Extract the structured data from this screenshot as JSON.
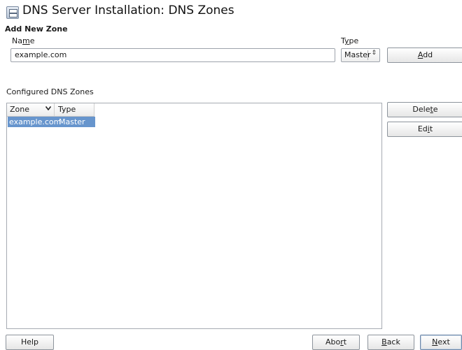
{
  "header": {
    "title": "DNS Server Installation: DNS Zones",
    "icon": "dns-server-icon"
  },
  "add_zone": {
    "section_title": "Add New Zone",
    "name_label_pre": "Na",
    "name_label_u": "m",
    "name_label_post": "e",
    "name_value": "example.com",
    "type_label_pre": "T",
    "type_label_u": "y",
    "type_label_post": "pe",
    "type_selected": "Master",
    "add_pre": "",
    "add_u": "A",
    "add_post": "dd"
  },
  "zones": {
    "label": "Configured DNS Zones",
    "columns": [
      "Zone",
      "Type"
    ],
    "rows": [
      {
        "zone": "example.com",
        "type": "Master",
        "selected": true
      }
    ],
    "delete_pre": "Dele",
    "delete_u": "t",
    "delete_post": "e",
    "edit_pre": "Ed",
    "edit_u": "i",
    "edit_post": "t"
  },
  "footer": {
    "help": "Help",
    "abort_pre": "Abo",
    "abort_u": "r",
    "abort_post": "t",
    "back_pre": "",
    "back_u": "B",
    "back_post": "ack",
    "next_pre": "",
    "next_u": "N",
    "next_post": "ext"
  },
  "colors": {
    "selection": "#6795cd"
  }
}
